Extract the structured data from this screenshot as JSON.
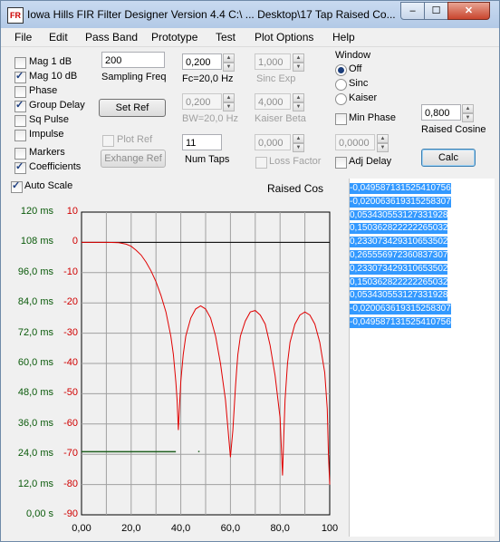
{
  "window": {
    "title": "Iowa Hills FIR Filter Designer  Version 4.4   C:\\ ... Desktop\\17 Tap Raised Co...",
    "icon": "app-icon",
    "min_label": "–",
    "max_label": "☐",
    "close_label": "✕"
  },
  "menu": [
    "File",
    "Edit",
    "Pass Band",
    "Prototype",
    "Test",
    "Plot Options",
    "Help"
  ],
  "display_options": [
    {
      "label": "Mag   1 dB",
      "checked": false
    },
    {
      "label": "Mag 10 dB",
      "checked": true
    },
    {
      "label": "Phase",
      "checked": false
    },
    {
      "label": "Group Delay",
      "checked": true
    },
    {
      "label": "Sq Pulse",
      "checked": false
    },
    {
      "label": "Impulse",
      "checked": false
    },
    {
      "label": "Markers",
      "checked": false
    },
    {
      "label": "Coefficients",
      "checked": true
    }
  ],
  "sampling": {
    "value": "200",
    "label": "Sampling Freq"
  },
  "set_ref": "Set Ref",
  "plot_ref": "Plot Ref",
  "exchange_ref": "Exhange Ref",
  "fc": {
    "value": "0,200",
    "label": "Fc=20,0 Hz"
  },
  "bw": {
    "value": "0,200",
    "label": "BW=20,0 Hz"
  },
  "num_taps": {
    "value": "11",
    "label": "Num Taps"
  },
  "sinc_exp": {
    "value": "1,000",
    "label": "Sinc Exp"
  },
  "kaiser_beta": {
    "value": "4,000",
    "label": "Kaiser Beta"
  },
  "loss_factor": {
    "value": "0,000",
    "label": "Loss Factor"
  },
  "window_group": {
    "title": "Window",
    "options": [
      {
        "label": "Off",
        "selected": true
      },
      {
        "label": "Sinc",
        "selected": false
      },
      {
        "label": "Kaiser",
        "selected": false
      }
    ]
  },
  "min_phase": {
    "label": "Min Phase",
    "checked": false
  },
  "adj_delay": {
    "value": "0,0000",
    "label": "Adj Delay",
    "checked": false
  },
  "raised_cosine": {
    "value": "0,800",
    "label": "Raised Cosine"
  },
  "calc": "Calc",
  "auto_scale": {
    "label": "Auto Scale",
    "checked": true
  },
  "chart_data": {
    "type": "line",
    "title": "Raised Cos",
    "x_ticks": [
      "0,00",
      "20,0",
      "40,0",
      "60,0",
      "80,0",
      "100"
    ],
    "xlim": [
      0,
      100
    ],
    "left_ticks": [
      "120 ms",
      "108 ms",
      "96,0 ms",
      "84,0 ms",
      "72,0 ms",
      "60,0 ms",
      "48,0 ms",
      "36,0 ms",
      "24,0 ms",
      "12,0 ms",
      "0,00 s"
    ],
    "right_ticks": [
      "10",
      "0",
      "-10",
      "-20",
      "-30",
      "-40",
      "-50",
      "-60",
      "-70",
      "-80",
      "-90"
    ],
    "ylim_db": [
      -90,
      10
    ],
    "grid": true,
    "colors": {
      "magnitude": "#e00000",
      "group_delay": "#1f5f1f",
      "zero_line": "#000000",
      "left_axis": "#0a5a0a",
      "right_axis": "#d00000"
    },
    "magnitude_db": {
      "x": [
        0,
        5,
        10,
        15,
        18,
        20,
        22,
        24,
        26,
        28,
        30,
        32,
        34,
        36,
        37,
        38,
        38.5,
        39,
        39.5,
        40,
        41,
        42,
        44,
        46,
        48,
        50,
        52,
        54,
        56,
        58,
        60,
        61,
        62,
        62.5,
        63,
        64,
        66,
        68,
        70,
        72,
        74,
        76,
        78,
        80,
        81,
        81.5,
        82,
        83,
        84,
        86,
        88,
        90,
        92,
        94,
        96,
        98,
        99,
        99.5,
        100
      ],
      "y": [
        0,
        0,
        0,
        -0.1,
        -0.6,
        -1.3,
        -2.6,
        -4.2,
        -6.5,
        -9.4,
        -13,
        -17.5,
        -23,
        -31,
        -37,
        -46,
        -52,
        -62,
        -54,
        -46,
        -37,
        -31,
        -25,
        -22,
        -21,
        -22,
        -25,
        -31,
        -40,
        -52,
        -71,
        -62,
        -48,
        -42,
        -37,
        -31,
        -26,
        -23,
        -22.5,
        -24,
        -27,
        -34,
        -44,
        -58,
        -77,
        -64,
        -52,
        -40,
        -33,
        -27,
        -24,
        -23,
        -24,
        -27,
        -33,
        -43,
        -55,
        -70,
        -80
      ]
    },
    "group_delay_ms": {
      "x": [
        0,
        38
      ],
      "y": [
        25,
        25
      ]
    },
    "group_delay_dot": {
      "x": 47,
      "y": 25
    }
  },
  "coefficients": [
    "-0,049587131525410756",
    "-0,020063619315258307",
    "0,053430553127331928",
    "0,150362822222265032",
    "0,233073429310653502",
    "0,265556972360837307",
    "0,233073429310653502",
    "0,150362822222265032",
    "0,053430553127331928",
    "-0,020063619315258307",
    "-0,049587131525410756"
  ]
}
